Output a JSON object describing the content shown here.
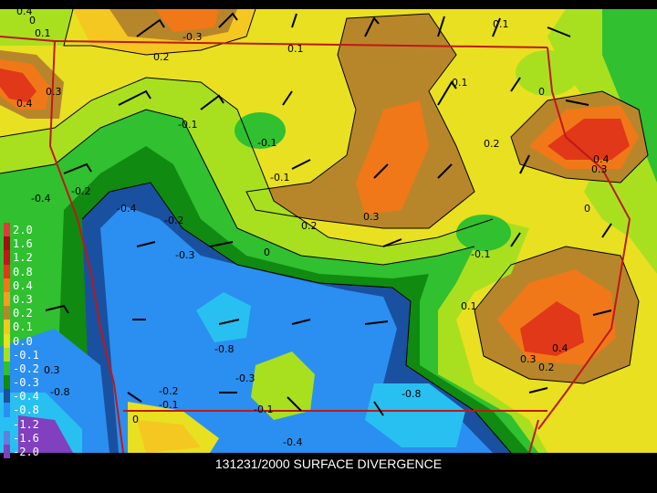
{
  "caption": "131231/2000 SURFACE DIVERGENCE",
  "legend": [
    {
      "label": "2.0",
      "color": "#e03a3a"
    },
    {
      "label": "1.6",
      "color": "#a01010"
    },
    {
      "label": "1.2",
      "color": "#c01818"
    },
    {
      "label": "0.8",
      "color": "#e03818"
    },
    {
      "label": "0.4",
      "color": "#f07818"
    },
    {
      "label": "0.3",
      "color": "#f0a020"
    },
    {
      "label": "0.2",
      "color": "#b8862a"
    },
    {
      "label": "0.1",
      "color": "#f4c820"
    },
    {
      "label": "0.0",
      "color": "#e8e020"
    },
    {
      "label": "-0.1",
      "color": "#a8e020"
    },
    {
      "label": "-0.2",
      "color": "#30c030"
    },
    {
      "label": "-0.3",
      "color": "#108a10"
    },
    {
      "label": "-0.4",
      "color": "#1a50a0"
    },
    {
      "label": "-0.8",
      "color": "#2a8ff0"
    },
    {
      "label": "-1.2",
      "color": "#28c0f0"
    },
    {
      "label": "-1.6",
      "color": "#6080e0"
    },
    {
      "label": "-2.0",
      "color": "#8040c0"
    }
  ],
  "contour_labels": [
    "0",
    "0.1",
    "-0.3",
    "0.1",
    "0.1",
    "0.2",
    "0.3",
    "0.4",
    "-0.1",
    "-0.1",
    "-0.1",
    "0.1",
    "0",
    "0.2",
    "0.4",
    "0.3",
    "0.3",
    "-0.4",
    "-0.2",
    "-0.3",
    "0.2",
    "0",
    "-0.1",
    "0",
    "0.1",
    "-0.8",
    "-0.8",
    "-0.3",
    "-0.2",
    "-0.1",
    "-0.1",
    "-0.4",
    "0.3",
    "0.4",
    "0.2",
    "-0.8",
    "0.3",
    "0.4",
    "0",
    "-0.2",
    "-0.4"
  ]
}
